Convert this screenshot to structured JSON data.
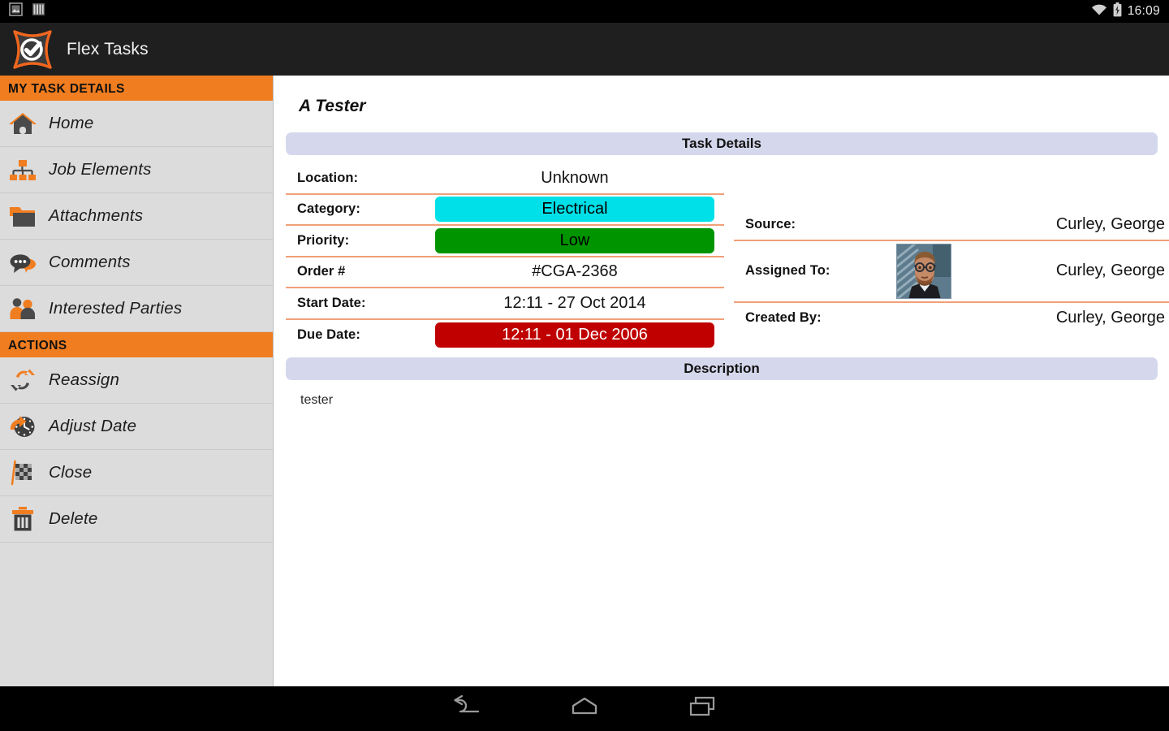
{
  "status_bar": {
    "icons": [
      "screenshot-icon",
      "bars-icon",
      "wifi-icon",
      "battery-charging-icon"
    ],
    "clock": "16:09"
  },
  "app_bar": {
    "logo": "flex-tasks-logo",
    "title": "Flex Tasks"
  },
  "sidebar": {
    "sections": [
      {
        "header": "MY TASK DETAILS",
        "items": [
          {
            "label": "Home",
            "icon": "home-icon"
          },
          {
            "label": "Job Elements",
            "icon": "org-chart-icon"
          },
          {
            "label": "Attachments",
            "icon": "folder-icon"
          },
          {
            "label": "Comments",
            "icon": "speech-bubbles-icon"
          },
          {
            "label": "Interested Parties",
            "icon": "people-icon"
          }
        ]
      },
      {
        "header": "ACTIONS",
        "items": [
          {
            "label": "Reassign",
            "icon": "reassign-arrows-icon"
          },
          {
            "label": "Adjust Date",
            "icon": "clock-arrow-icon"
          },
          {
            "label": "Close",
            "icon": "checkered-flag-icon"
          },
          {
            "label": "Delete",
            "icon": "trash-icon"
          }
        ]
      }
    ]
  },
  "main": {
    "task_title": "A Tester",
    "task_details_header": "Task Details",
    "left_fields": [
      {
        "label": "Location:",
        "value": "Unknown",
        "style": "plain"
      },
      {
        "label": "Category:",
        "value": "Electrical",
        "style": "badge-cyan"
      },
      {
        "label": "Priority:",
        "value": "Low",
        "style": "badge-green"
      },
      {
        "label": "Order #",
        "value": "#CGA-2368",
        "style": "plain"
      },
      {
        "label": "Start Date:",
        "value": "12:11 - 27 Oct 2014",
        "style": "plain"
      },
      {
        "label": "Due Date:",
        "value": "12:11 - 01 Dec 2006",
        "style": "badge-red"
      }
    ],
    "right_fields": [
      {
        "label": "Source:",
        "value": "Curley, George",
        "avatar": false
      },
      {
        "label": "Assigned To:",
        "value": "Curley, George",
        "avatar": true
      },
      {
        "label": "Created By:",
        "value": "Curley, George",
        "avatar": false
      }
    ],
    "description_header": "Description",
    "description_text": "tester"
  },
  "nav_bar": {
    "buttons": [
      "back-icon",
      "home-icon",
      "recents-icon"
    ]
  },
  "colors": {
    "accent_orange": "#f07d20",
    "sidebar_bg": "#dcdcdc",
    "band_lavender": "#d5d8ec",
    "divider": "#f0a078",
    "badge_cyan": "#00e0e8",
    "badge_green": "#009500",
    "badge_red": "#c00000",
    "appbar_bg": "#1f1f1f"
  }
}
